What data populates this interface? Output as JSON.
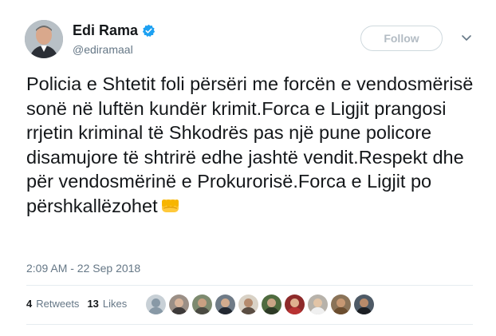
{
  "author": {
    "display_name": "Edi Rama",
    "handle": "@ediramaal",
    "verified_icon": "verified-badge-icon",
    "avatar_icon": "profile-photo"
  },
  "header": {
    "follow_label": "Follow",
    "menu_icon": "chevron-down-icon"
  },
  "tweet": {
    "text": "Policia e Shtetit foli përsëri me forcën e vendosmërisë sonë në luftën kundër krimit.Forca e Ligjit prangosi rrjetin kriminal të Shkodrës pas një pune policore disamujore të shtrirë edhe jashtë vendit.Respekt dhe për vendosmërinë e Prokurorisë.Forca e Ligjit po përshkallëzohet",
    "emoji_icon": "raised-fist-emoji",
    "timestamp": "2:09 AM - 22 Sep 2018"
  },
  "stats": {
    "retweets_count": "4",
    "retweets_label": "Retweets",
    "likes_count": "13",
    "likes_label": "Likes"
  },
  "colors": {
    "verified_blue": "#1da1f2",
    "muted_text": "#657786",
    "divider": "#e6ecf0"
  },
  "liker_avatars": [
    "default-avatar",
    "user-photo",
    "user-photo",
    "user-photo",
    "user-photo",
    "user-photo",
    "user-photo",
    "user-photo",
    "user-photo",
    "user-photo"
  ]
}
